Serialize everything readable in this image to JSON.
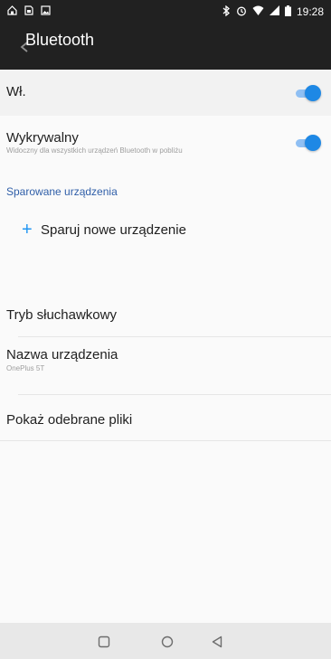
{
  "status_bar": {
    "left_icons": [
      "home-icon",
      "sd-card-icon",
      "image-icon"
    ],
    "right_icons": [
      "bluetooth-icon",
      "alarm-icon",
      "wifi-icon",
      "signal-icon",
      "battery-icon"
    ],
    "time": "19:28"
  },
  "header": {
    "title": "Bluetooth",
    "back_icon": "back-arrow-icon",
    "background": "#212121"
  },
  "settings": {
    "on": {
      "label": "Wł.",
      "enabled": true
    },
    "discoverable": {
      "label": "Wykrywalny",
      "summary": "Widoczny dla wszystkich urządzeń Bluetooth w pobliżu",
      "enabled": true
    },
    "paired_section": {
      "title": "Sparowane urządzenia"
    },
    "pair_new": {
      "label": "Sparuj nowe urządzenie",
      "icon": "plus-icon"
    },
    "headset_mode": {
      "label": "Tryb słuchawkowy"
    },
    "device_name": {
      "label": "Nazwa urządzenia",
      "value": "OnePlus 5T"
    },
    "received_files": {
      "label": "Pokaż odebrane pliki"
    }
  },
  "navbar": {
    "buttons": [
      "recents-icon",
      "home-icon",
      "back-icon"
    ]
  },
  "colors": {
    "accent": "#1e88e5",
    "section_title": "#2f5ea8",
    "switch_track": "#8fbff3"
  }
}
